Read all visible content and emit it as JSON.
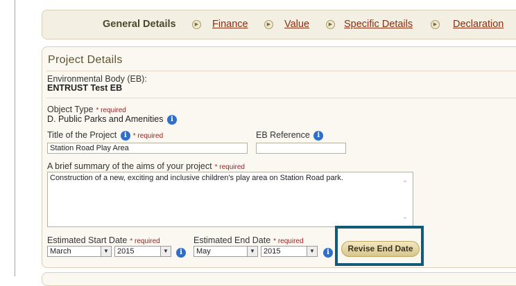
{
  "steps": [
    {
      "label": "General Details",
      "current": true
    },
    {
      "label": "Finance",
      "current": false
    },
    {
      "label": "Value",
      "current": false
    },
    {
      "label": "Specific Details",
      "current": false
    },
    {
      "label": "Declaration",
      "current": false
    }
  ],
  "step_separator_icon": "circle-arrow-right-icon",
  "project": {
    "title": "Project Details",
    "eb_label": "Environmental Body (EB):",
    "eb_value": "ENTRUST Test EB",
    "object_type_label": "Object Type",
    "object_type_value": "D. Public Parks and Amenities",
    "title_label": "Title of the Project",
    "title_value": "Station Road Play Area",
    "eb_ref_label": "EB Reference",
    "eb_ref_value": "",
    "summary_label": "A brief summary of the aims of your project",
    "summary_value": "Construction of a new, exciting and inclusive children's play area on Station Road park.",
    "start_label": "Estimated Start Date",
    "start_month": "March",
    "start_year": "2015",
    "end_label": "Estimated End Date",
    "end_month": "May",
    "end_year": "2015",
    "required_text": "* required",
    "revise_button": "Revise End Date"
  },
  "colors": {
    "highlight": "#135a78",
    "info_icon": "#2f6fc9",
    "required": "#9b1c1c",
    "link": "#8a2d10"
  }
}
